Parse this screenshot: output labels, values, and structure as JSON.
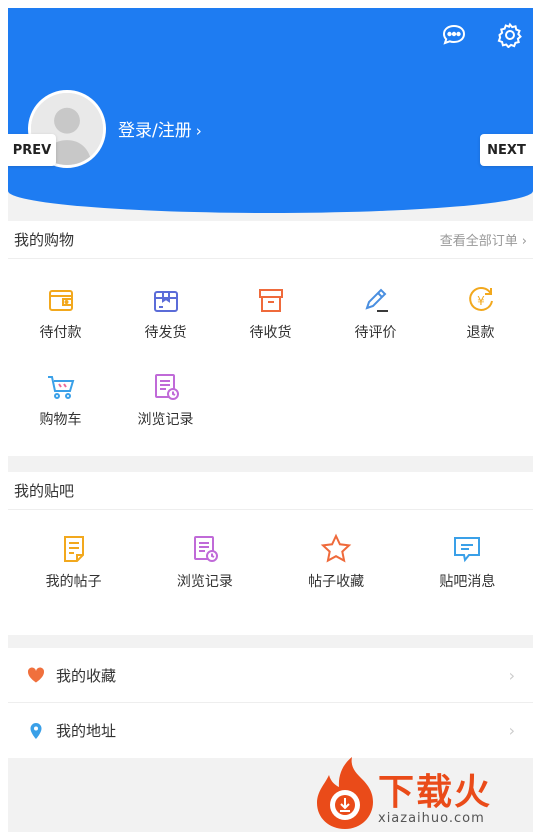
{
  "header": {
    "login_label": "登录/注册",
    "prev_label": "PREV",
    "next_label": "NEXT",
    "bg_color": "#1e7cf2"
  },
  "shopping": {
    "title": "我的购物",
    "more_label": "查看全部订单",
    "items": [
      {
        "label": "待付款",
        "icon": "wallet-icon",
        "color": "#f2a81d"
      },
      {
        "label": "待发货",
        "icon": "package-icon",
        "color": "#5b6cd8"
      },
      {
        "label": "待收货",
        "icon": "box-icon",
        "color": "#ef6a3b"
      },
      {
        "label": "待评价",
        "icon": "pen-icon",
        "color": "#4a8fe0"
      },
      {
        "label": "退款",
        "icon": "refund-icon",
        "color": "#f2a81d"
      },
      {
        "label": "购物车",
        "icon": "cart-icon",
        "color": "#3aa0e8"
      },
      {
        "label": "浏览记录",
        "icon": "history-icon",
        "color": "#c06ad8"
      }
    ]
  },
  "tieba": {
    "title": "我的贴吧",
    "items": [
      {
        "label": "我的帖子",
        "icon": "post-icon",
        "color": "#f2a81d"
      },
      {
        "label": "浏览记录",
        "icon": "history-icon",
        "color": "#c06ad8"
      },
      {
        "label": "帖子收藏",
        "icon": "star-icon",
        "color": "#ef6a3b"
      },
      {
        "label": "贴吧消息",
        "icon": "message-icon",
        "color": "#3aa0e8"
      }
    ]
  },
  "links": [
    {
      "label": "我的收藏",
      "icon": "heart-icon",
      "color": "#f0703d"
    },
    {
      "label": "我的地址",
      "icon": "location-icon",
      "color": "#3aa0e8"
    }
  ],
  "watermark": {
    "brand": "下载火",
    "url": "xiazaihuo.com"
  }
}
